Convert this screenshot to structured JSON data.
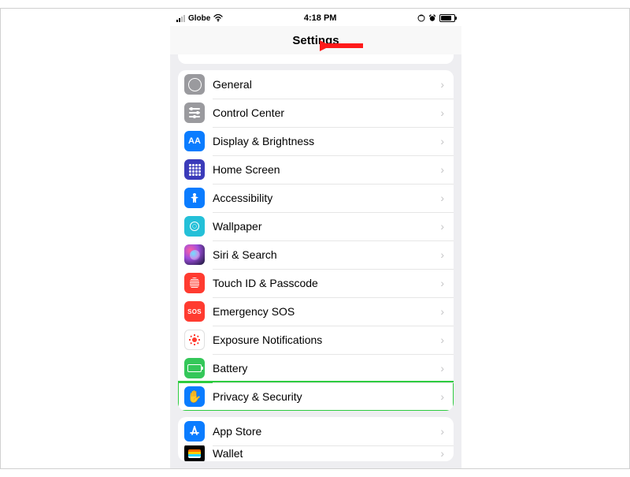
{
  "status_bar": {
    "carrier": "Globe",
    "time": "4:18 PM"
  },
  "nav": {
    "title": "Settings"
  },
  "group1": [
    {
      "key": "general",
      "label": "General"
    },
    {
      "key": "control-center",
      "label": "Control Center"
    },
    {
      "key": "display",
      "label": "Display & Brightness"
    },
    {
      "key": "home-screen",
      "label": "Home Screen"
    },
    {
      "key": "accessibility",
      "label": "Accessibility"
    },
    {
      "key": "wallpaper",
      "label": "Wallpaper"
    },
    {
      "key": "siri",
      "label": "Siri & Search"
    },
    {
      "key": "touchid",
      "label": "Touch ID & Passcode"
    },
    {
      "key": "sos",
      "label": "Emergency SOS",
      "icon_text": "SOS"
    },
    {
      "key": "exposure",
      "label": "Exposure Notifications"
    },
    {
      "key": "battery",
      "label": "Battery"
    },
    {
      "key": "privacy",
      "label": "Privacy & Security",
      "highlight": true
    }
  ],
  "group2": [
    {
      "key": "appstore",
      "label": "App Store"
    },
    {
      "key": "wallet",
      "label": "Wallet"
    }
  ],
  "display_icon_text": "AA",
  "annotations": {
    "arrow_color": "#ff1a1a",
    "highlight_color": "#2ecc40",
    "arrow_points_to": "nav.title",
    "highlight_target": "privacy"
  }
}
